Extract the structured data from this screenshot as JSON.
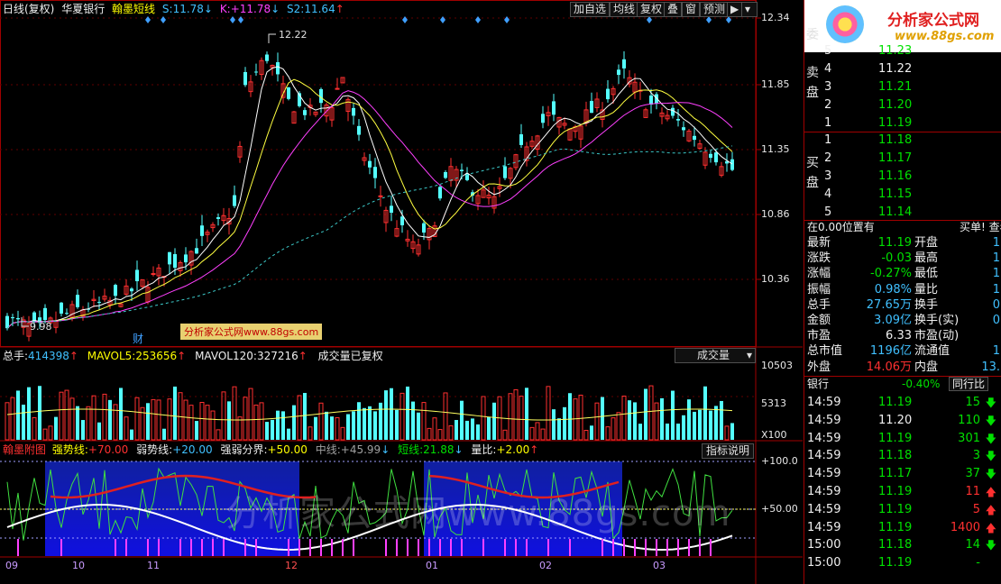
{
  "header": {
    "period": "日线(复权)",
    "stock": "华夏银行",
    "indicator": "翰墨短线",
    "s_label": "S:",
    "s_value": "11.78",
    "k_label": "K:",
    "k_value": "+11.78",
    "s2_label": "S2:",
    "s2_value": "11.64"
  },
  "toolbar": {
    "btn1": "加自选",
    "btn2": "均线",
    "btn3": "复权",
    "btn4": "叠",
    "btn5": "窗",
    "btn6": "预测"
  },
  "price_axis": [
    "12.34",
    "11.85",
    "11.35",
    "10.86",
    "10.36"
  ],
  "price_annotations": {
    "high": "12.22",
    "low": "9.98",
    "fin": "财"
  },
  "watermark_small": "分析家公式网www.88gs.com",
  "watermark_big": "分析家公式网www.88gs.com",
  "volume": {
    "total_label": "总手:",
    "total_value": "414398",
    "mavol5_label": "MAVOL5:",
    "mavol5_value": "253656",
    "mavol120_label": "MAVOL120:",
    "mavol120_value": "327216",
    "note": "成交量已复权",
    "selector": "成交量",
    "axis": [
      "10503",
      "5313",
      "X100"
    ]
  },
  "sub": {
    "name": "翰墨附图",
    "strong_label": "强势线:",
    "strong_value": "+70.00",
    "weak_label": "弱势线:",
    "weak_value": "+20.00",
    "split_label": "强弱分界:",
    "split_value": "+50.00",
    "mid_label": "中线:",
    "mid_value": "+45.99",
    "short_label": "短线:",
    "short_value": "21.88",
    "vr_label": "量比:",
    "vr_value": "+2.00",
    "help": "指标说明",
    "axis": [
      "+100.0",
      "+50.00"
    ]
  },
  "xaxis": [
    "09",
    "10",
    "11",
    "12",
    "01",
    "02",
    "03"
  ],
  "logo": {
    "text": "分析家公式网",
    "url": "www.88gs.com"
  },
  "orderbook": {
    "wei_label": "委",
    "sell_label": "卖盘",
    "buy_label": "买盘",
    "sell": [
      {
        "n": "5",
        "p": "11.23"
      },
      {
        "n": "4",
        "p": "11.22"
      },
      {
        "n": "3",
        "p": "11.21"
      },
      {
        "n": "2",
        "p": "11.20"
      },
      {
        "n": "1",
        "p": "11.19"
      }
    ],
    "buy": [
      {
        "n": "1",
        "p": "11.18"
      },
      {
        "n": "2",
        "p": "11.17"
      },
      {
        "n": "3",
        "p": "11.16"
      },
      {
        "n": "4",
        "p": "11.15"
      },
      {
        "n": "5",
        "p": "11.14"
      }
    ]
  },
  "position": {
    "left": "在0.00位置有",
    "right": "买单! 查看"
  },
  "quote": [
    {
      "l": "最新",
      "v": "11.19",
      "l2": "开盘",
      "v2": "1"
    },
    {
      "l": "涨跌",
      "v": "-0.03",
      "l2": "最高",
      "v2": "1"
    },
    {
      "l": "涨幅",
      "v": "-0.27%",
      "l2": "最低",
      "v2": "1"
    },
    {
      "l": "振幅",
      "v": "0.98%",
      "l2": "量比",
      "v2": "1"
    },
    {
      "l": "总手",
      "v": "27.65万",
      "l2": "换手",
      "v2": "0"
    },
    {
      "l": "金额",
      "v": "3.09亿",
      "l2": "换手(实)",
      "v2": "0"
    },
    {
      "l": "市盈",
      "v": "6.33",
      "l2": "市盈(动)",
      "v2": ""
    },
    {
      "l": "总市值",
      "v": "1196亿",
      "l2": "流通值",
      "v2": "1"
    },
    {
      "l": "外盘",
      "v": "14.06万",
      "l2": "内盘",
      "v2": "13."
    }
  ],
  "industry": {
    "name": "银行",
    "change": "-0.40%",
    "btn": "同行比"
  },
  "ticks": [
    {
      "t": "14:59",
      "p": "11.19",
      "v": "15",
      "d": "down"
    },
    {
      "t": "14:59",
      "p": "11.20",
      "v": "110",
      "d": "down"
    },
    {
      "t": "14:59",
      "p": "11.19",
      "v": "301",
      "d": "down"
    },
    {
      "t": "14:59",
      "p": "11.18",
      "v": "3",
      "d": "down"
    },
    {
      "t": "14:59",
      "p": "11.17",
      "v": "37",
      "d": "down"
    },
    {
      "t": "14:59",
      "p": "11.19",
      "v": "11",
      "d": "up"
    },
    {
      "t": "14:59",
      "p": "11.19",
      "v": "5",
      "d": "up"
    },
    {
      "t": "14:59",
      "p": "11.19",
      "v": "1400",
      "d": "up"
    },
    {
      "t": "15:00",
      "p": "11.18",
      "v": "14",
      "d": "down"
    },
    {
      "t": "15:00",
      "p": "11.19",
      "v": "-",
      "d": "none"
    }
  ]
}
